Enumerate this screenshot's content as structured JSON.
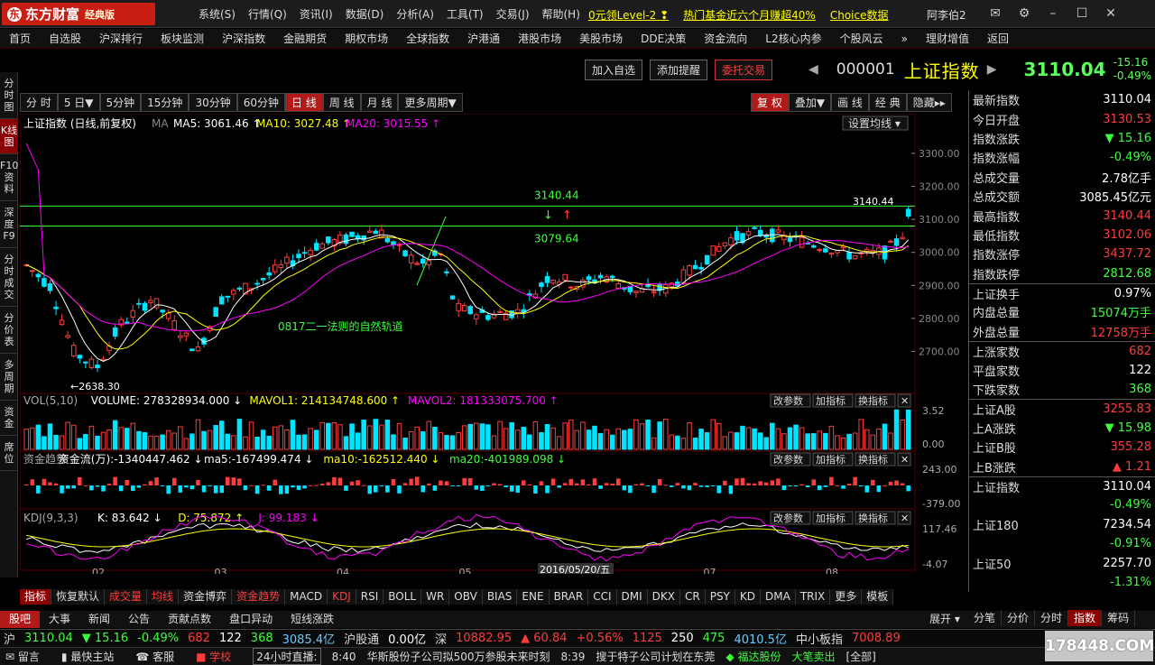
{
  "app": {
    "logo": "东方财富",
    "edition": "经典版"
  },
  "menu": [
    "系统(S)",
    "行情(Q)",
    "资讯(I)",
    "数据(D)",
    "分析(A)",
    "工具(T)",
    "交易(J)",
    "帮助(H)"
  ],
  "promo": [
    "0元领Level-2 ❢",
    "热门基金近六个月赚超40%",
    "Choice数据"
  ],
  "user": "阿李伯2",
  "nav": [
    "首页",
    "自选股",
    "沪深排行",
    "板块监测",
    "沪深指数",
    "金融期货",
    "期权市场",
    "全球指数",
    "沪港通",
    "港股市场",
    "美股市场",
    "DDE决策",
    "资金流向",
    "L2核心内参",
    "个股风云",
    "»",
    "理财增值",
    "返回"
  ],
  "leftnav": [
    "分时图",
    "K线图",
    "F10资料",
    "深度F9",
    "分时成交",
    "分价表",
    "多周期",
    "资金",
    "席位"
  ],
  "actions": [
    "加入自选",
    "添加提醒",
    "委托交易"
  ],
  "index": {
    "code": "000001",
    "name": "上证指数",
    "price": "3110.04",
    "change": "-15.16",
    "pct": "-0.49%"
  },
  "period_tabs": [
    "分 时",
    "5 日▼",
    "5分钟",
    "15分钟",
    "30分钟",
    "60分钟",
    "日 线",
    "周 线",
    "月 线",
    "更多周期▼"
  ],
  "right_tabs": [
    "复 权",
    "叠加▼",
    "画 线",
    "经 典",
    "隐藏▸▸"
  ],
  "kline": {
    "title": "上证指数 (日线,前复权)",
    "ma_label": "MA",
    "ma5": "MA5: 3061.46 ↑",
    "ma10": "MA10: 3027.48 ↑",
    "ma20": "MA20: 3015.55 ↑",
    "setting": "设置均线 ▾",
    "annot_hi": "3140.44",
    "annot_lo": "3079.64",
    "annot_low_point": "2638.30",
    "annot_high_point": "3140.44",
    "annotation": "0817二一法则的自然轨道",
    "date_label": "2016/05/20/五",
    "x_months": [
      "02",
      "03",
      "04",
      "05",
      "06",
      "07",
      "08"
    ],
    "y_ticks": [
      "3300.00",
      "3200.00",
      "3100.00",
      "3000.00",
      "2900.00",
      "2800.00",
      "2700.00"
    ]
  },
  "vol": {
    "title": "VOL(5,10)",
    "volume": "VOLUME: 278328934.000 ↓",
    "m1": "MAVOL1: 214134748.600 ↑",
    "m2": "MAVOL2: 181333075.700 ↑",
    "ticks": [
      "3.52",
      "0.00"
    ]
  },
  "flow": {
    "title": "资金趋势",
    "main": "资金流(万):-1340447.462 ↓",
    "m5": "ma5:-167499.474 ↓",
    "m10": "ma10:-162512.440 ↓",
    "m20": "ma20:-401989.098 ↓",
    "ticks": [
      "243.00",
      "-379.00"
    ]
  },
  "kdj": {
    "title": "KDJ(9,3,3)",
    "k": "K: 83.642 ↓",
    "d": "D: 75.872 ↑",
    "j": "J: 99.183 ↓",
    "ticks": [
      "117.46",
      "-4.07"
    ]
  },
  "panel_btns": [
    "改参数",
    "加指标",
    "换指标",
    "✕"
  ],
  "right_panel": {
    "group1": [
      {
        "l": "最新指数",
        "v": "3110.04",
        "c": "wh"
      },
      {
        "l": "今日开盘",
        "v": "3130.53",
        "c": "up"
      },
      {
        "l": "指数涨跌",
        "v": "▼ 15.16",
        "c": "dn"
      },
      {
        "l": "指数涨幅",
        "v": "-0.49%",
        "c": "dn"
      },
      {
        "l": "总成交量",
        "v": "2.78亿手",
        "c": "wh"
      },
      {
        "l": "总成交额",
        "v": "3085.45亿元",
        "c": "wh"
      },
      {
        "l": "最高指数",
        "v": "3140.44",
        "c": "up"
      },
      {
        "l": "最低指数",
        "v": "3102.06",
        "c": "up"
      },
      {
        "l": "指数涨停",
        "v": "3437.72",
        "c": "up"
      },
      {
        "l": "指数跌停",
        "v": "2812.68",
        "c": "dn"
      }
    ],
    "group2": [
      {
        "l": "上证换手",
        "v": "0.97%",
        "c": "wh"
      },
      {
        "l": "内盘总量",
        "v": "15074万手",
        "c": "dn"
      },
      {
        "l": "外盘总量",
        "v": "12758万手",
        "c": "up"
      }
    ],
    "group3": [
      {
        "l": "上涨家数",
        "v": "682",
        "c": "up"
      },
      {
        "l": "平盘家数",
        "v": "122",
        "c": "wh"
      },
      {
        "l": "下跌家数",
        "v": "368",
        "c": "dn"
      }
    ],
    "group4": [
      {
        "l": "上证A股",
        "v": "3255.83",
        "c": "up"
      },
      {
        "l": "上A涨跌",
        "v": "▼ 15.98",
        "c": "dn"
      },
      {
        "l": "上证B股",
        "v": "355.28",
        "c": "up"
      },
      {
        "l": "上B涨跌",
        "v": "▲ 1.21",
        "c": "up"
      }
    ],
    "group5": [
      {
        "l": "上证指数",
        "v": "3110.04",
        "v2": "-0.49%"
      },
      {
        "l": "上证180",
        "v": "7234.54",
        "v2": "-0.91%"
      },
      {
        "l": "上证50",
        "v": "2257.70",
        "v2": "-1.31%"
      }
    ]
  },
  "bottom_tabs": [
    "指标",
    "恢复默认",
    "成交量",
    "均线",
    "资金博弈",
    "资金趋势",
    "MACD",
    "KDJ",
    "RSI",
    "BOLL",
    "WR",
    "OBV",
    "BIAS",
    "ENE",
    "BRAR",
    "CCI",
    "DMI",
    "DKX",
    "CR",
    "PSY",
    "KD",
    "DMA",
    "TRIX",
    "更多",
    "模板"
  ],
  "news_tabs": [
    "股吧",
    "大事",
    "新闻",
    "公告",
    "贡献点数",
    "盘口异动",
    "短线涨跌"
  ],
  "expand": "展开 ▾",
  "right_bottom_tabs": [
    "分笔",
    "分价",
    "分时",
    "指数",
    "筹码"
  ],
  "quote_bar": {
    "sh": "沪",
    "sh_px": "3110.04",
    "sh_chg": "▼ 15.16",
    "sh_pct": "-0.49%",
    "sh_adv": "682",
    "sh_flat": "122",
    "sh_dec": "368",
    "sh_amt": "3085.4亿",
    "hgt": "沪股通",
    "hgt_v": "0.00亿",
    "sz": "深",
    "sz_px": "10882.95",
    "sz_chg": "▲ 60.84",
    "sz_pct": "+0.56%",
    "sz_adv": "1125",
    "sz_flat": "250",
    "sz_dec": "475",
    "sz_amt": "4010.5亿",
    "zx": "中小板指",
    "zx_px": "7008.89"
  },
  "status_bar": {
    "a": "留言",
    "b": "最快主站",
    "c": "客服",
    "d": "学校",
    "e": "24小时直播:",
    "t1": "8:40",
    "n1": "华斯股份子公司拟500万参股未来时刻",
    "t2": "8:39",
    "n2": "搜于特子公司计划在东莞",
    "n3": "◆ 福达股份",
    "n4": "大笔卖出",
    "n5": "[全部]"
  },
  "watermark": "178448.COM"
}
